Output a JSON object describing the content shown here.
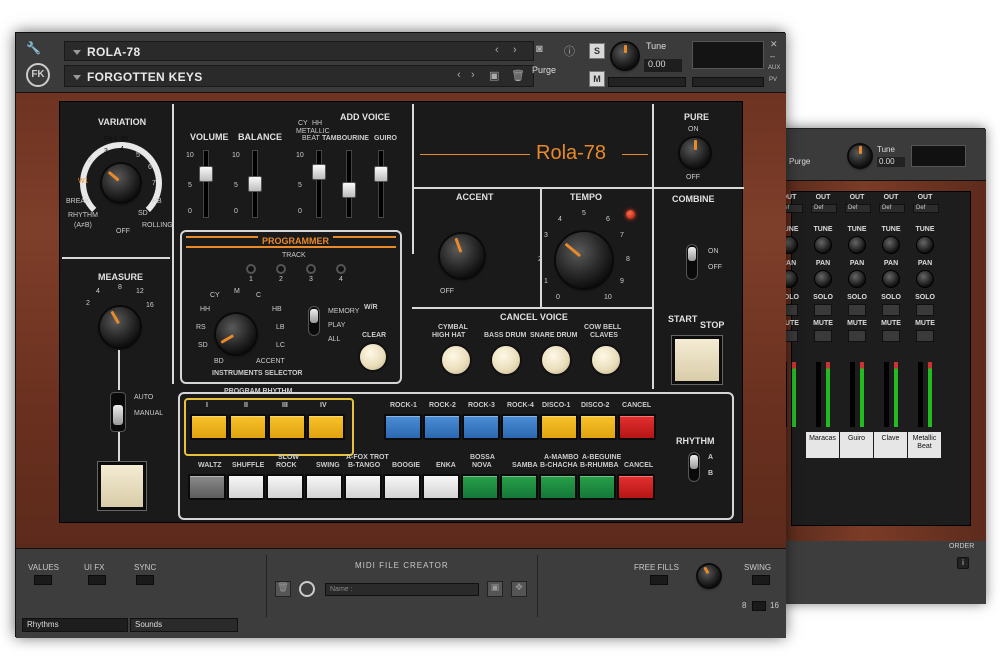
{
  "header": {
    "instrument_name": "ROLA-78",
    "library_name": "FORGOTTEN KEYS",
    "preset": "Purge",
    "tune_label": "Tune",
    "tune_value": "0.00",
    "s_button": "S",
    "m_button": "M",
    "aux_label": "AUX",
    "pv_label": "PV",
    "logo": "FK"
  },
  "panel": {
    "variation": {
      "title": "VARIATION",
      "fill_in": "FILL IN",
      "w1": "W1",
      "w2": "2",
      "w3": "3",
      "w4": "4",
      "w5": "5",
      "w6": "6",
      "w7": "7",
      "break": "BREAK",
      "rhythm": "RHYTHM",
      "ab": "(A≠B)",
      "off": "OFF",
      "sd": "SD",
      "hb": "HB",
      "rolling": "ROLLING"
    },
    "volume": {
      "title": "VOLUME"
    },
    "balance": {
      "title": "BALANCE"
    },
    "add_voice": {
      "title": "ADD VOICE",
      "cy": "CY",
      "hh": "HH",
      "metallic": "METALLIC",
      "beat": "BEAT",
      "tambourine": "TAMBOURINE",
      "guiro": "GUIRO"
    },
    "scale": {
      "top": "10",
      "mid": "5",
      "bottom": "0"
    },
    "brand": "Rola-78",
    "accent": {
      "title": "ACCENT",
      "off": "OFF"
    },
    "tempo": {
      "title": "TEMPO",
      "t0": "0",
      "t1": "1",
      "t2": "2",
      "t3": "3",
      "t4": "4",
      "t5": "5",
      "t6": "6",
      "t7": "7",
      "t8": "8",
      "t9": "9",
      "t10": "10"
    },
    "pure": {
      "title": "PURE",
      "on": "ON",
      "off": "OFF"
    },
    "combine": {
      "title": "COMBINE",
      "on": "ON",
      "off": "OFF"
    },
    "start_stop": {
      "start": "START",
      "stop": "STOP"
    },
    "programmer": {
      "title": "PROGRAMMER",
      "track": "TRACK",
      "t1": "1",
      "t2": "2",
      "t3": "3",
      "t4": "4",
      "cy": "CY",
      "m": "M",
      "c": "C",
      "hh": "HH",
      "hb": "HB",
      "rs": "RS",
      "lb": "LB",
      "sd": "SD",
      "lc": "LC",
      "bd": "BD",
      "accent": "ACCENT",
      "selector": "INSTRUMENTS SELECTOR",
      "memory": "MEMORY",
      "wr": "W/R",
      "play": "PLAY",
      "all": "ALL",
      "clear": "CLEAR"
    },
    "measure": {
      "title": "MEASURE",
      "m2": "2",
      "m4": "4",
      "m8": "8",
      "m12": "12",
      "m16": "16",
      "auto": "AUTO",
      "manual": "MANUAL"
    },
    "cancel_voice": {
      "title": "CANCEL VOICE",
      "cymbal": "CYMBAL",
      "high_hat": "HIGH HAT",
      "bass_drum": "BASS DRUM",
      "snare_drum": "SNARE DRUM",
      "cow_bell": "COW BELL",
      "claves": "CLAVES"
    },
    "program_rhythm": {
      "title": "PROGRAM RHYTHM",
      "p1": "I",
      "p2": "II",
      "p3": "III",
      "p4": "IV"
    },
    "row1": [
      "ROCK-1",
      "ROCK-2",
      "ROCK-3",
      "ROCK-4",
      "DISCO-1",
      "DISCO-2",
      "CANCEL"
    ],
    "row2": {
      "waltz": "WALTZ",
      "shuffle": "SHUFFLE",
      "slow": "SLOW",
      "rock": "ROCK",
      "swing": "SWING",
      "foxtrot": "A-FOX TROT",
      "tango": "B-TANGO",
      "boogie": "BOOGIE",
      "enka": "ENKA",
      "bossa": "BOSSA",
      "nova": "NOVA",
      "samba": "SAMBA",
      "mambo": "A-MAMBO",
      "chacha": "B-CHACHA",
      "beguine": "A-BEGUINE",
      "rhumba": "B-RHUMBA",
      "cancel": "CANCEL"
    },
    "rhythm_ab": {
      "title": "RHYTHM",
      "a": "A",
      "b": "B"
    }
  },
  "footer": {
    "values": "VALUES",
    "ui_fx": "UI FX",
    "sync": "SYNC",
    "midi_title": "MIDI FILE CREATOR",
    "name_placeholder": "Name :",
    "free_fills": "FREE FILLS",
    "swing": "SWING",
    "s8": "8",
    "s16": "16",
    "tab_rhythms": "Rhythms",
    "tab_sounds": "Sounds"
  },
  "back": {
    "preset": "Purge",
    "tune": "Tune",
    "tune_value": "0.00",
    "order": "ORDER",
    "out": "OUT",
    "def": "Def",
    "tune_lbl": "TUNE",
    "pan": "PAN",
    "solo": "SOLO",
    "mute": "MUTE",
    "channels": [
      "Maracas",
      "Guiro",
      "Clave",
      "Metallic Beat"
    ]
  },
  "colors": {
    "accent": "#e8892a",
    "wood": "#7b3c27"
  }
}
